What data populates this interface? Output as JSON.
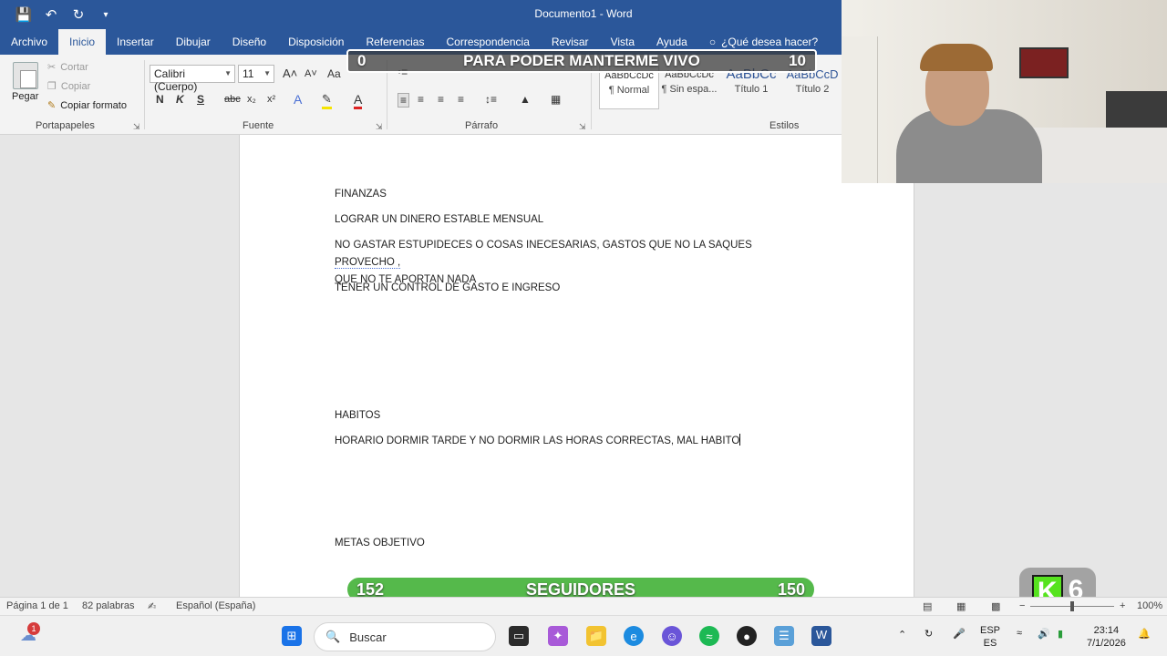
{
  "titlebar": {
    "title": "Documento1 - Word"
  },
  "tabs": [
    "Archivo",
    "Inicio",
    "Insertar",
    "Dibujar",
    "Diseño",
    "Disposición",
    "Referencias",
    "Correspondencia",
    "Revisar",
    "Vista",
    "Ayuda"
  ],
  "tell_me": "¿Qué desea hacer?",
  "clipboard": {
    "paste": "Pegar",
    "cut": "Cortar",
    "copy": "Copiar",
    "format_painter": "Copiar formato",
    "group": "Portapapeles"
  },
  "font": {
    "name": "Calibri (Cuerpo)",
    "size": "11",
    "group": "Fuente",
    "aa": "Aa",
    "bold": "N",
    "italic": "K",
    "underline": "S",
    "strike": "abc",
    "sub": "x₂",
    "sup": "x²"
  },
  "paragraph": {
    "group": "Párrafo"
  },
  "styles": {
    "group": "Estilos",
    "items": [
      {
        "preview": "AaBbCcDc",
        "name": "¶ Normal"
      },
      {
        "preview": "AaBbCcDc",
        "name": "¶ Sin espa..."
      },
      {
        "preview": "AaBbCc",
        "name": "Título 1"
      },
      {
        "preview": "AaBbCcD",
        "name": "Título 2"
      }
    ]
  },
  "document": {
    "p1": "FINANZAS",
    "p2": "LOGRAR UN DINERO ESTABLE MENSUAL",
    "p3a": "NO GASTAR ESTUPIDECES O COSAS INECESARIAS, GASTOS QUE NO LA SAQUES ",
    "p3b": "PROVECHO ,",
    "p3c": "QUE NO TE APORTAN NADA",
    "p4": "TENER UN CONTROL DE GASTO E INGRESO",
    "p5": "HABITOS",
    "p6": "HORARIO DORMIR TARDE Y NO DORMIR LAS HORAS CORRECTAS, MAL HABITO",
    "p7": "METAS OBJETIVO"
  },
  "overlay_top": {
    "left": "0",
    "title": "PARA PODER MANTERME VIVO",
    "right": "10"
  },
  "overlay_bottom": {
    "left": "152",
    "title": "SEGUIDORES",
    "right": "150"
  },
  "kick_badge": {
    "letter": "K",
    "count": "6"
  },
  "statusbar": {
    "page": "Página 1 de 1",
    "words": "82 palabras",
    "language": "Español (España)",
    "zoom": "100%",
    "zoom_fraction": 0.5
  },
  "taskbar": {
    "search": "Buscar",
    "lang1": "ESP",
    "lang2": "ES",
    "time": "23:14",
    "date": "7/1/2026",
    "notif_count": "1"
  }
}
